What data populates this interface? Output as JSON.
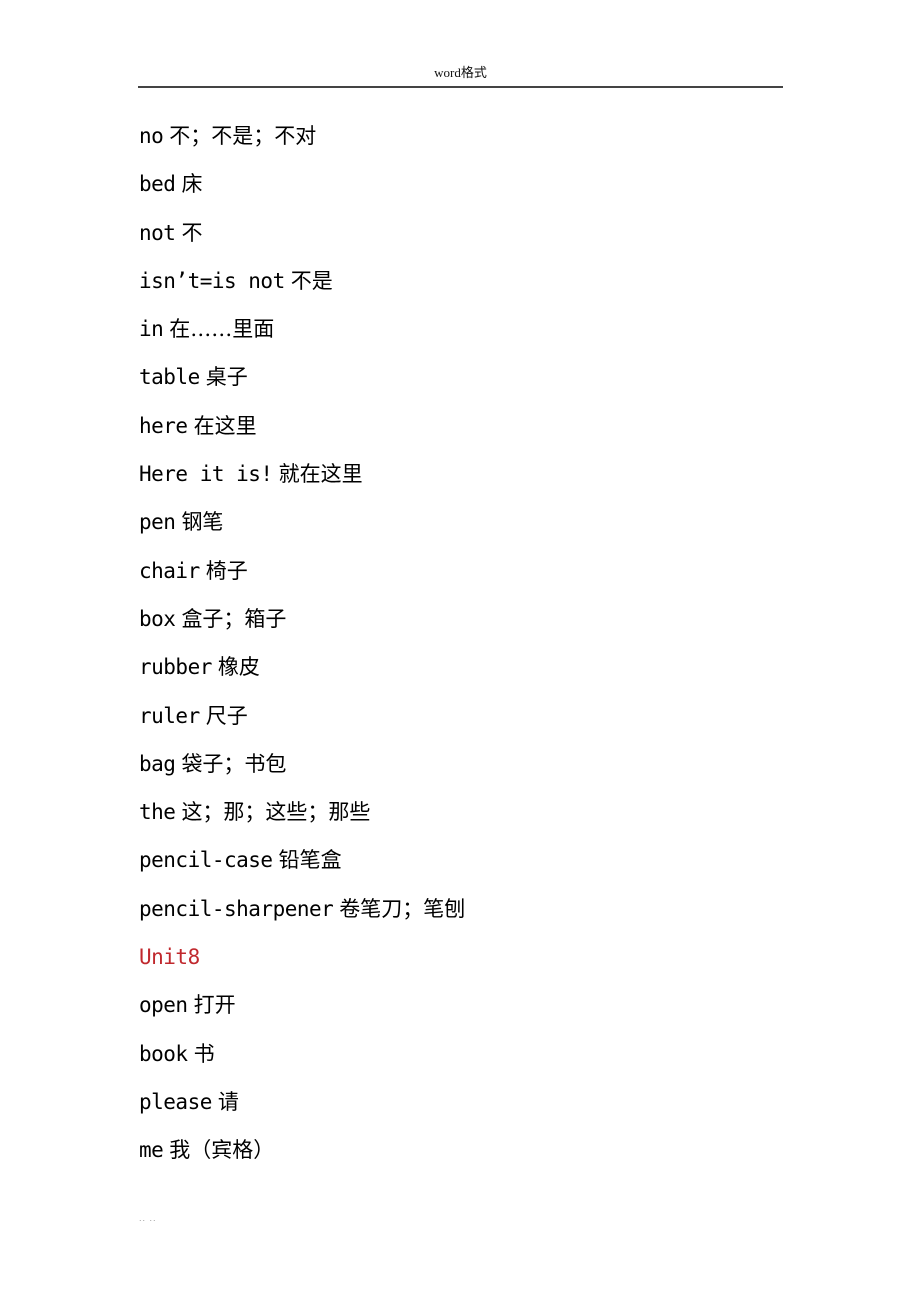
{
  "header": {
    "title": "word格式"
  },
  "entries": [
    {
      "en": "no",
      "zh": "不；不是；不对"
    },
    {
      "en": "bed",
      "zh": "床"
    },
    {
      "en": "not",
      "zh": "不"
    },
    {
      "en": "isn’t=is not",
      "zh": "不是"
    },
    {
      "en": "in",
      "zh": "在……里面"
    },
    {
      "en": "table",
      "zh": "桌子"
    },
    {
      "en": "here",
      "zh": "在这里"
    },
    {
      "en": "Here it is!",
      "zh": "就在这里"
    },
    {
      "en": "pen",
      "zh": "钢笔"
    },
    {
      "en": "chair",
      "zh": "椅子"
    },
    {
      "en": "box",
      "zh": "盒子；箱子"
    },
    {
      "en": "rubber",
      "zh": "橡皮"
    },
    {
      "en": "ruler",
      "zh": "尺子"
    },
    {
      "en": "bag",
      "zh": "袋子；书包"
    },
    {
      "en": "the",
      "zh": "这；那；这些；那些"
    },
    {
      "en": "pencil-case",
      "zh": "铅笔盒"
    },
    {
      "en": "pencil-sharpener",
      "zh": "卷笔刀；笔刨"
    }
  ],
  "unit_heading": {
    "label": "Unit8",
    "color": "#c0282d"
  },
  "entries_unit8": [
    {
      "en": "open",
      "zh": "打开"
    },
    {
      "en": "book",
      "zh": "书"
    },
    {
      "en": "please",
      "zh": "请"
    },
    {
      "en": "me",
      "zh": "我（宾格）"
    }
  ],
  "footer": {
    "text": ".. .."
  }
}
